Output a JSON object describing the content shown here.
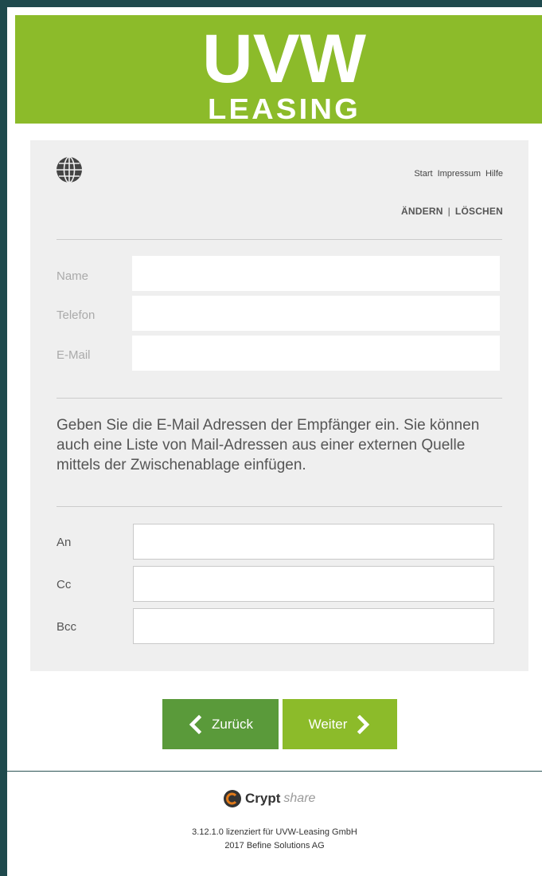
{
  "header": {
    "logo_line1": "UVW",
    "logo_line2": "LEASING",
    "brand_color": "#8cbb2a"
  },
  "nav": {
    "language_icon": "globe-icon",
    "links": [
      "Start",
      "Impressum",
      "Hilfe"
    ]
  },
  "actions": {
    "change_label": "ÄNDERN",
    "separator": "|",
    "delete_label": "LÖSCHEN"
  },
  "sender": {
    "name_label": "Name",
    "name_value": "",
    "phone_label": "Telefon",
    "phone_value": "",
    "email_label": "E-Mail",
    "email_value": ""
  },
  "instruction": "Geben Sie die E-Mail Adressen der Empfänger ein. Sie können auch eine Liste von Mail-Adressen aus einer externen Quelle mittels der Zwischenablage einfügen.",
  "recipients": {
    "to_label": "An",
    "to_value": "",
    "cc_label": "Cc",
    "cc_value": "",
    "bcc_label": "Bcc",
    "bcc_value": ""
  },
  "buttons": {
    "back_label": "Zurück",
    "back_icon": "chevron-left-icon",
    "next_label": "Weiter",
    "next_icon": "chevron-right-icon",
    "back_color": "#5a9a3a",
    "next_color": "#8cbb2a"
  },
  "footer": {
    "product_word": "Crypt",
    "product_suffix": "share",
    "license_line": "3.12.1.0 lizenziert für UVW-Leasing GmbH",
    "copyright_line": "2017 Befine Solutions AG"
  }
}
